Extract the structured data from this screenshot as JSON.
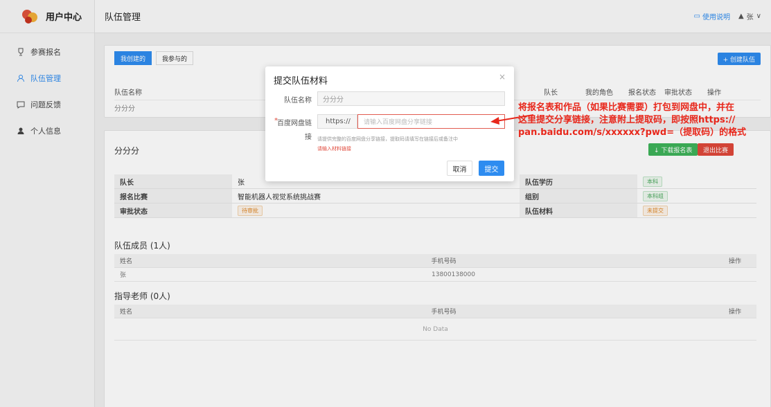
{
  "sidebar": {
    "app_name": "用户中心",
    "items": [
      {
        "label": "参赛报名"
      },
      {
        "label": "队伍管理"
      },
      {
        "label": "问题反馈"
      },
      {
        "label": "个人信息"
      }
    ]
  },
  "header": {
    "title": "队伍管理",
    "help_label": "使用说明",
    "user_name": "张"
  },
  "main": {
    "tabs": [
      {
        "label": "我创建的"
      },
      {
        "label": "我参与的"
      }
    ],
    "create_button": "+ 创建队伍",
    "table_headers": [
      "队伍名称",
      "队长",
      "我的角色",
      "报名状态",
      "审批状态",
      "操作"
    ],
    "table_rows": [
      [
        "分分分"
      ]
    ],
    "team_name": "分分分",
    "download_button": "↓ 下载报名表",
    "quit_button": "退出比赛",
    "info": {
      "captain_label": "队长",
      "captain_value": "张",
      "education_label": "队伍学历",
      "education_value": "本科",
      "competition_label": "报名比赛",
      "competition_value": "智能机器人视觉系统挑战赛",
      "group_label": "组别",
      "group_value": "本科组",
      "approval_label": "审批状态",
      "approval_value": "待审批",
      "material_label": "队伍材料",
      "material_value": "未提交"
    },
    "members": {
      "title": "队伍成员 (1人)",
      "headers": [
        "姓名",
        "手机号码",
        "操作"
      ],
      "rows": [
        [
          "张",
          "13800138000"
        ]
      ]
    },
    "teachers": {
      "title": "指导老师 (0人)",
      "headers": [
        "姓名",
        "手机号码",
        "操作"
      ],
      "empty": "No Data"
    }
  },
  "modal": {
    "title": "提交队伍材料",
    "close": "×",
    "team_name_label": "队伍名称",
    "team_name_value": "分分分",
    "required_mark": "*",
    "link_label": "百度网盘链",
    "link_label_wrap": "接",
    "prefix": "https://",
    "link_placeholder": "请输入百度网盘分享链接",
    "hint": "请提供完整的百度网盘分享链接，提取码请填写在链接后或备注中",
    "error": "请输入材料链接",
    "cancel": "取消",
    "submit": "提交"
  },
  "annotation": {
    "line1": "将报名表和作品（如果比赛需要）打包到网盘中，并在",
    "line2": "这里提交分享链接，注意附上提取码，即按照https://",
    "line3": "pan.baidu.com/s/xxxxxx?pwd=（提取码）的格式"
  },
  "colors": {
    "accent": "#2e8cf0",
    "annotation": "#e8271b",
    "success": "#3eb35a",
    "danger": "#e0483a"
  }
}
